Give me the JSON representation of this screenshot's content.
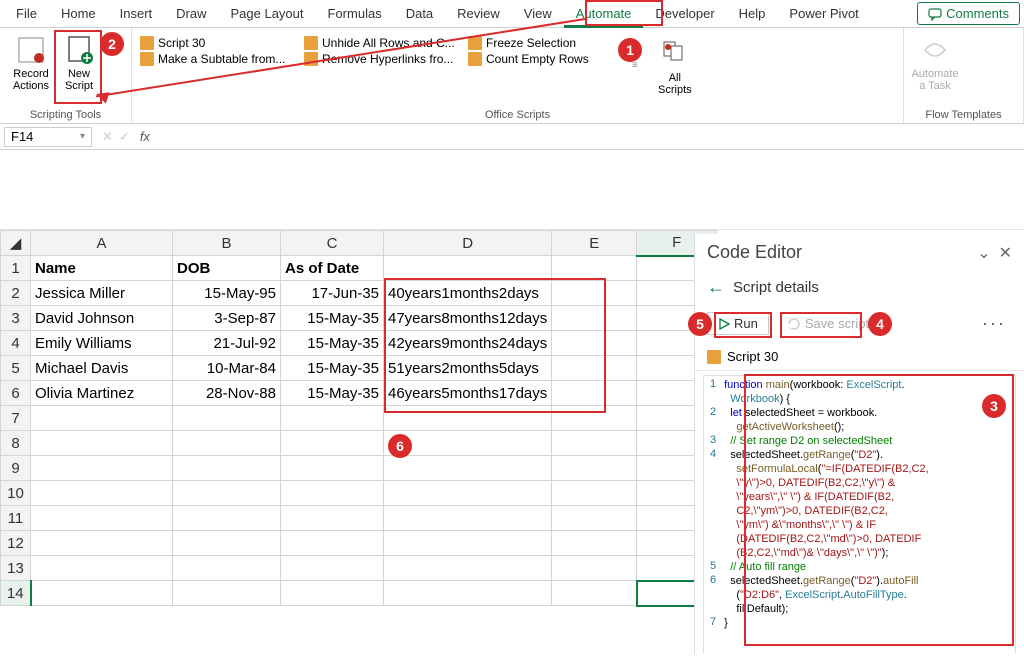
{
  "ribbon": {
    "tabs": [
      "File",
      "Home",
      "Insert",
      "Draw",
      "Page Layout",
      "Formulas",
      "Data",
      "Review",
      "View",
      "Automate",
      "Developer",
      "Help",
      "Power Pivot"
    ],
    "comments": "Comments",
    "groups": {
      "scripting_tools": "Scripting Tools",
      "office_scripts": "Office Scripts",
      "flow_templates": "Flow Templates"
    },
    "record_actions": "Record Actions",
    "new_script": "New Script",
    "all_scripts": "All Scripts",
    "automate_task": "Automate a Task",
    "scripts": {
      "col1": [
        "Script 30",
        "Make a Subtable from..."
      ],
      "col2": [
        "Unhide All Rows and C...",
        "Remove Hyperlinks fro..."
      ],
      "col3": [
        "Freeze Selection",
        "Count Empty Rows"
      ]
    }
  },
  "formula_bar": {
    "name_box": "F14"
  },
  "sheet": {
    "cols": [
      "A",
      "B",
      "C",
      "D",
      "E",
      "F"
    ],
    "headers": {
      "A": "Name",
      "B": "DOB",
      "C": "As of Date"
    },
    "rows": [
      {
        "A": "Jessica Miller",
        "B": "15-May-95",
        "C": "17-Jun-35",
        "D": "40years1months2days"
      },
      {
        "A": "David Johnson",
        "B": "3-Sep-87",
        "C": "15-May-35",
        "D": "47years8months12days"
      },
      {
        "A": "Emily Williams",
        "B": "21-Jul-92",
        "C": "15-May-35",
        "D": "42years9months24days"
      },
      {
        "A": "Michael Davis",
        "B": "10-Mar-84",
        "C": "15-May-35",
        "D": "51years2months5days"
      },
      {
        "A": "Olivia Martinez",
        "B": "28-Nov-88",
        "C": "15-May-35",
        "D": "46years5months17days"
      }
    ]
  },
  "editor": {
    "title": "Code Editor",
    "details": "Script details",
    "run": "Run",
    "save": "Save script",
    "script_name": "Script 30",
    "code": {
      "l1a": "function ",
      "l1b": "main",
      "l1c": "(workbook: ",
      "l1d": "ExcelScript",
      "l1e": ".",
      "l1f": "Workbook",
      "l1g": ") {",
      "l2a": "let",
      "l2b": " selectedSheet = workbook.",
      "l2c": "getActiveWorksheet",
      "l2d": "();",
      "l3": "// Set range D2 on selectedSheet",
      "l4a": "selectedSheet.",
      "l4b": "getRange",
      "l4c": "(",
      "l4d": "\"D2\"",
      "l4e": ").",
      "l4f": "setFormulaLocal",
      "l4g": "(",
      "l4h": "\"=IF(DATEDIF(B2,C2,",
      "l4i": "\\\"y\\\")>0, DATEDIF(B2,C2,\\\"y\\\") & ",
      "l4j": "\\\"years\\\",\\\" \\\") & IF(DATEDIF(B2,",
      "l4k": "C2,\\\"ym\\\")>0, DATEDIF(B2,C2,",
      "l4l": "\\\"ym\\\") &\\\"months\\\",\\\" \\\") & IF",
      "l4m": "(DATEDIF(B2,C2,\\\"md\\\")>0, DATEDIF",
      "l4n": "(B2,C2,\\\"md\\\")& \\\"days\\\",\\\" \\\")\"",
      "l4o": ");",
      "l5": "// Auto fill range",
      "l6a": "selectedSheet.",
      "l6b": "getRange",
      "l6c": "(",
      "l6d": "\"D2\"",
      "l6e": ").",
      "l6f": "autoFill",
      "l6g": "(",
      "l6h": "\"D2:D6\"",
      "l6i": ", ",
      "l6j": "ExcelScript",
      "l6k": ".",
      "l6l": "AutoFillType",
      "l6m": ".",
      "l6n": "fillDefault",
      "l6o": ");",
      "l7": "}"
    }
  },
  "annotations": {
    "b1": "1",
    "b2": "2",
    "b3": "3",
    "b4": "4",
    "b5": "5",
    "b6": "6"
  }
}
